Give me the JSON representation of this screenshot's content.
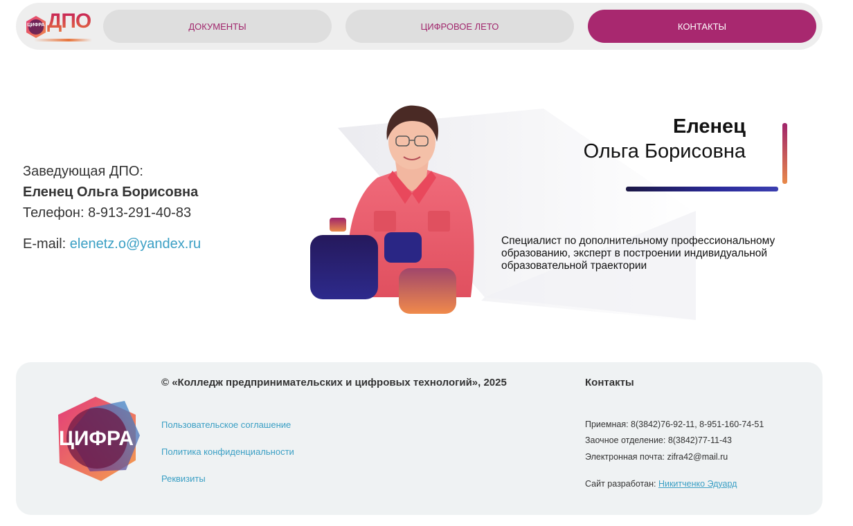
{
  "nav": {
    "logo_text": "ДПО",
    "logo_badge": "ЦИФРА",
    "items": [
      {
        "label": "ДОКУМЕНТЫ",
        "active": false
      },
      {
        "label": "ЦИФРОВОЕ ЛЕТО",
        "active": false
      },
      {
        "label": "КОНТАКТЫ",
        "active": true
      }
    ],
    "accent_color": "#a8286f"
  },
  "contact": {
    "role": "Заведующая ДПО:",
    "name": "Еленец Ольга Борисовна",
    "phone": "Телефон: 8-913-291-40-83",
    "email_label": "E-mail:",
    "email": "elenetz.o@yandex.ru"
  },
  "card": {
    "last_name": "Еленец",
    "first_names": "Ольга Борисовна",
    "description": "Специалист по дополнительному профессиональному образованию, эксперт в построении индивидуальной образовательной траектории"
  },
  "footer": {
    "logo_text": "ЦИФРА",
    "copyright": "© «Колледж предпринимательских и цифровых технологий», 2025",
    "links": [
      "Пользовательское соглашение",
      "Политика конфиденциальности",
      "Реквизиты"
    ],
    "contacts_title": "Контакты",
    "reception": "Приемная: 8(3842)76-92-11, 8-951-160-74-51",
    "correspondence": "Заочное отделение: 8(3842)77-11-43",
    "email": "Электронная почта: zifra42@mail.ru",
    "developed_label": "Сайт разработан:",
    "developer": "Никитченко Эдуард"
  }
}
